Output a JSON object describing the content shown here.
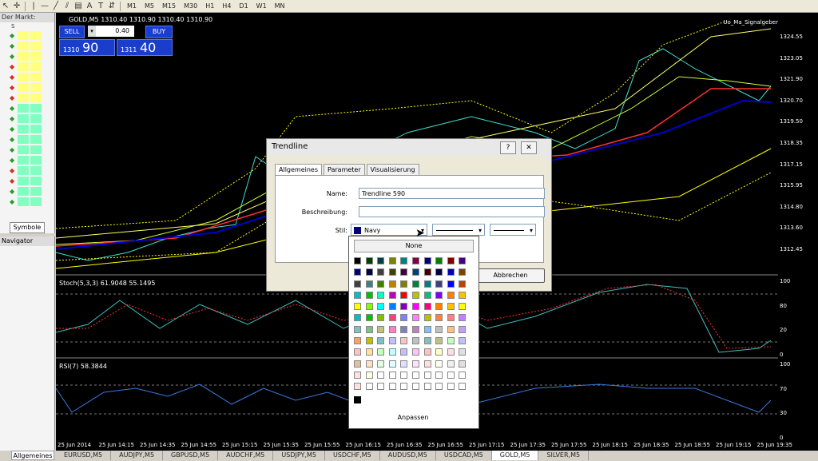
{
  "toolbar": {
    "timeframes": [
      "M1",
      "M5",
      "M15",
      "M30",
      "H1",
      "H4",
      "D1",
      "W1",
      "MN"
    ],
    "text_tool": "A"
  },
  "market_watch": {
    "title": "Der Markt:",
    "header": "S",
    "rows": [
      {
        "dir": "up",
        "color": "#ffff80"
      },
      {
        "dir": "up",
        "color": "#ffff80"
      },
      {
        "dir": "up",
        "color": "#ffff80"
      },
      {
        "dir": "down",
        "color": "#ffff80"
      },
      {
        "dir": "down",
        "color": "#ffff80"
      },
      {
        "dir": "down",
        "color": "#ffff80"
      },
      {
        "dir": "down",
        "color": "#ffff80"
      },
      {
        "dir": "up",
        "color": "#80ffc0"
      },
      {
        "dir": "up",
        "color": "#80ffc0"
      },
      {
        "dir": "up",
        "color": "#80ffc0"
      },
      {
        "dir": "up",
        "color": "#80ffc0"
      },
      {
        "dir": "up",
        "color": "#80ffc0"
      },
      {
        "dir": "up",
        "color": "#80ffc0"
      },
      {
        "dir": "down",
        "color": "#80ffc0"
      },
      {
        "dir": "down",
        "color": "#80ffc0"
      },
      {
        "dir": "up",
        "color": "#80ffc0"
      },
      {
        "dir": "up",
        "color": "#80ffc0"
      }
    ],
    "tab": "Symbole"
  },
  "navigator": {
    "title": "Navigator",
    "tab": "Allgemeines"
  },
  "chart": {
    "title": "GOLD,M5  1310.40 1310.90 1310.40 1310.90",
    "signal": "Uo_Ma_Signalgeber",
    "trade": {
      "sell": "SELL",
      "buy": "BUY",
      "lot": "0.40",
      "bid_small": "1310",
      "bid_big": "90",
      "ask_small": "1311",
      "ask_big": "40"
    },
    "price_axis": [
      "1324.55",
      "1323.05",
      "1321.90",
      "1320.70",
      "1319.50",
      "1318.35",
      "1317.15",
      "1315.95",
      "1314.80",
      "1313.60",
      "1312.45"
    ],
    "stoch_label": "Stoch(5,3,3) 61.9048 55.1495",
    "stoch_axis": [
      "100",
      "80",
      "20",
      "0"
    ],
    "rsi_label": "RSI(7) 58.3844",
    "rsi_axis": [
      "100",
      "70",
      "30",
      "0"
    ],
    "time_axis": [
      "25 Jun 2014",
      "25 Jun 14:15",
      "25 Jun 14:35",
      "25 Jun 14:55",
      "25 Jun 15:15",
      "25 Jun 15:35",
      "25 Jun 15:55",
      "25 Jun 16:15",
      "25 Jun 16:35",
      "25 Jun 16:55",
      "25 Jun 17:15",
      "25 Jun 17:35",
      "25 Jun 17:55",
      "25 Jun 18:15",
      "25 Jun 18:35",
      "25 Jun 18:55",
      "25 Jun 19:15",
      "25 Jun 19:35"
    ]
  },
  "tabs": [
    "EURUSD,M5",
    "AUDJPY,M5",
    "GBPUSD,M5",
    "AUDCHF,M5",
    "USDJPY,M5",
    "USDCHF,M5",
    "AUDUSD,M5",
    "USDCAD,M5",
    "GOLD,M5",
    "SILVER,M5"
  ],
  "active_tab": "GOLD,M5",
  "dialog": {
    "title": "Trendline",
    "help": "?",
    "close": "✕",
    "tabs": [
      "Allgemeines",
      "Parameter",
      "Visualisierung"
    ],
    "name_label": "Name:",
    "name_value": "Trendline 590",
    "desc_label": "Beschreibung:",
    "desc_value": "",
    "style_label": "Stil:",
    "color_value": "Navy",
    "cancel": "Abbrechen"
  },
  "palette": {
    "none": "None",
    "custom": "Anpassen",
    "colors": [
      "#000000",
      "#004000",
      "#004040",
      "#808000",
      "#008080",
      "#800040",
      "#000080",
      "#008000",
      "#800000",
      "#400080",
      "#000080",
      "#000040",
      "#404040",
      "#404000",
      "#400040",
      "#004080",
      "#400000",
      "#000040",
      "#0000c0",
      "#804000",
      "#404040",
      "#408080",
      "#408000",
      "#c08000",
      "#808000",
      "#008040",
      "#008080",
      "#404080",
      "#0000ff",
      "#c04000",
      "#00c0c0",
      "#00c000",
      "#00ffc0",
      "#c000c0",
      "#ff0000",
      "#c0c000",
      "#00c080",
      "#8000ff",
      "#ff8000",
      "#ffc000",
      "#ffff00",
      "#80ff00",
      "#00ffff",
      "#0080ff",
      "#8000c0",
      "#ff00ff",
      "#ff0080",
      "#ff8000",
      "#ffc000",
      "#ffff00",
      "#00c0c0",
      "#00c000",
      "#80c000",
      "#ff4080",
      "#8080ff",
      "#ff80ff",
      "#c0c000",
      "#ff8040",
      "#ff8080",
      "#c080ff",
      "#80c0c0",
      "#80c080",
      "#c0c080",
      "#ff80c0",
      "#8080c0",
      "#c080c0",
      "#80c0ff",
      "#c0c0c0",
      "#ffc080",
      "#c0a0ff",
      "#ffa060",
      "#c0c000",
      "#80c0c0",
      "#c0c0ff",
      "#ffc0c0",
      "#c0c0c0",
      "#80c0c0",
      "#c0c080",
      "#c0ffc0",
      "#c0c0ff",
      "#ffc0c0",
      "#ffe0a0",
      "#c0ffc0",
      "#c0ffff",
      "#c0c0ff",
      "#ffc0ff",
      "#ffc0c0",
      "#ffffc0",
      "#ffe0e0",
      "#e0e0e0",
      "#e0c0a0",
      "#ffe0c0",
      "#e0ffe0",
      "#e0ffff",
      "#e0e0ff",
      "#ffe0ff",
      "#ffe0e0",
      "#fffff0",
      "#f0f0f0",
      "#e0e0e0",
      "#ffe0e0",
      "#ffffe0",
      "#ffffff",
      "#ffffff",
      "#ffffff",
      "#ffffff",
      "#ffffff",
      "#ffffff",
      "#ffffff",
      "#ffffff",
      "#ffe0e0",
      "#ffffff",
      "#ffffff",
      "#ffffff",
      "#ffffff",
      "#ffffff",
      "#ffffff",
      "#ffffff",
      "#ffffff",
      "#ffffff"
    ]
  }
}
